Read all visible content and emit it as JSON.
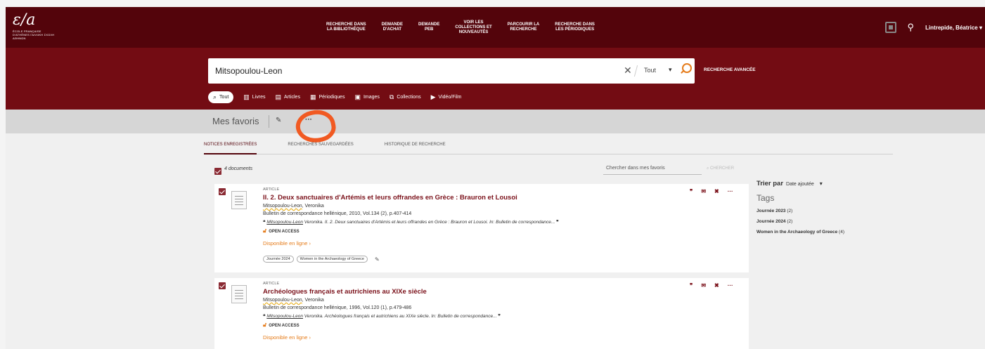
{
  "logo": {
    "mark": "ε/a",
    "subtitle": "ÉCOLE FRANÇAISE D'ATHÈNES ΓΑΛΛΙΚΗ ΣΧΟΛΗ ΑΘΗΝΩΝ"
  },
  "nav": [
    {
      "line1": "RECHERCHE DANS",
      "line2": "LA BIBLIOTHÈQUE",
      "line3": ""
    },
    {
      "line1": "DEMANDE",
      "line2": "D'ACHAT",
      "line3": ""
    },
    {
      "line1": "DEMANDE",
      "line2": "PEB",
      "line3": ""
    },
    {
      "line1": "VOIR LES",
      "line2": "COLLECTIONS ET",
      "line3": "NOUVEAUTÉS"
    },
    {
      "line1": "PARCOURIR LA",
      "line2": "RECHERCHE",
      "line3": ""
    },
    {
      "line1": "RECHERCHE DANS",
      "line2": "LES PÉRIODIQUES",
      "line3": ""
    }
  ],
  "user": {
    "name": "Lintrepide, Béatrice",
    "caret": "▾"
  },
  "search": {
    "value": "Mitsopoulou-Leon",
    "clear": "✕",
    "scope": "Tout",
    "caret": "▾",
    "advanced": "RECHERCHE AVANCÉE"
  },
  "tabs": [
    {
      "icon": "⌕",
      "label": "Tout"
    },
    {
      "icon": "▥",
      "label": "Livres"
    },
    {
      "icon": "▤",
      "label": "Articles"
    },
    {
      "icon": "▦",
      "label": "Périodiques"
    },
    {
      "icon": "▣",
      "label": "Images"
    },
    {
      "icon": "⧉",
      "label": "Collections"
    },
    {
      "icon": "▶",
      "label": "Vidéo/Film"
    }
  ],
  "favorites": {
    "title": "Mes favoris",
    "pen": "✎",
    "more": "···"
  },
  "subtabs": [
    "NOTICES ENREGISTRÉES",
    "RECHERCHES SAUVEGARDÉES",
    "HISTORIQUE DE RECHERCHE"
  ],
  "list": {
    "count": "4 documents",
    "search_placeholder": "Chercher dans mes favoris",
    "search_button": "⌕ CHERCHER"
  },
  "results": [
    {
      "type": "ARTICLE",
      "title": "II. 2. Deux sanctuaires d'Artémis et leurs offrandes en Grèce : Brauron et Lousoi",
      "author": "Mitsopoulou-Leon",
      "author_rest": ", Veronika",
      "source": "Bulletin de correspondance hellénique, 2010, Vol.134 (2), p.407-414",
      "cite_author": "Mitsopoulou-Leon",
      "cite": " Veronika. II. 2. Deux sanctuaires d'Artémis et leurs offrandes en Grèce : Brauron et Lousoi. In: Bulletin de correspondance...",
      "open_access": "OPEN ACCESS",
      "available": "Disponible en ligne  ›",
      "tags": [
        "Journée 2024",
        "Women in the Archaeology of Greece"
      ]
    },
    {
      "type": "ARTICLE",
      "title": "Archéologues français et autrichiens au XIXe siècle",
      "author": "Mitsopoulou-Leon",
      "author_rest": ", Veronika",
      "source": "Bulletin de correspondance hellénique, 1996, Vol.120 (1), p.479-486",
      "cite_author": "Mitsopoulou-Leon",
      "cite": " Veronika. Archéologues français et autrichiens au XIXe siècle. In: Bulletin de correspondance...",
      "open_access": "OPEN ACCESS",
      "available": "Disponible en ligne  ›",
      "tags": []
    }
  ],
  "actions": {
    "cite": "❞",
    "mail": "✉",
    "unpin": "✖",
    "more": "···"
  },
  "sidebar": {
    "sort_label": "Trier par",
    "sort_value": "Date ajoutée",
    "sort_caret": "▾",
    "tags_heading": "Tags",
    "tags": [
      {
        "name": "Journée 2023",
        "count": "(2)"
      },
      {
        "name": "Journée 2024",
        "count": "(2)"
      },
      {
        "name": "Women in the Archaeology of Greece",
        "count": "(4)"
      }
    ]
  },
  "colors": {
    "brand_dark": "#53040b",
    "brand": "#730c13",
    "accent": "#e57c1b",
    "title": "#7a1019"
  }
}
